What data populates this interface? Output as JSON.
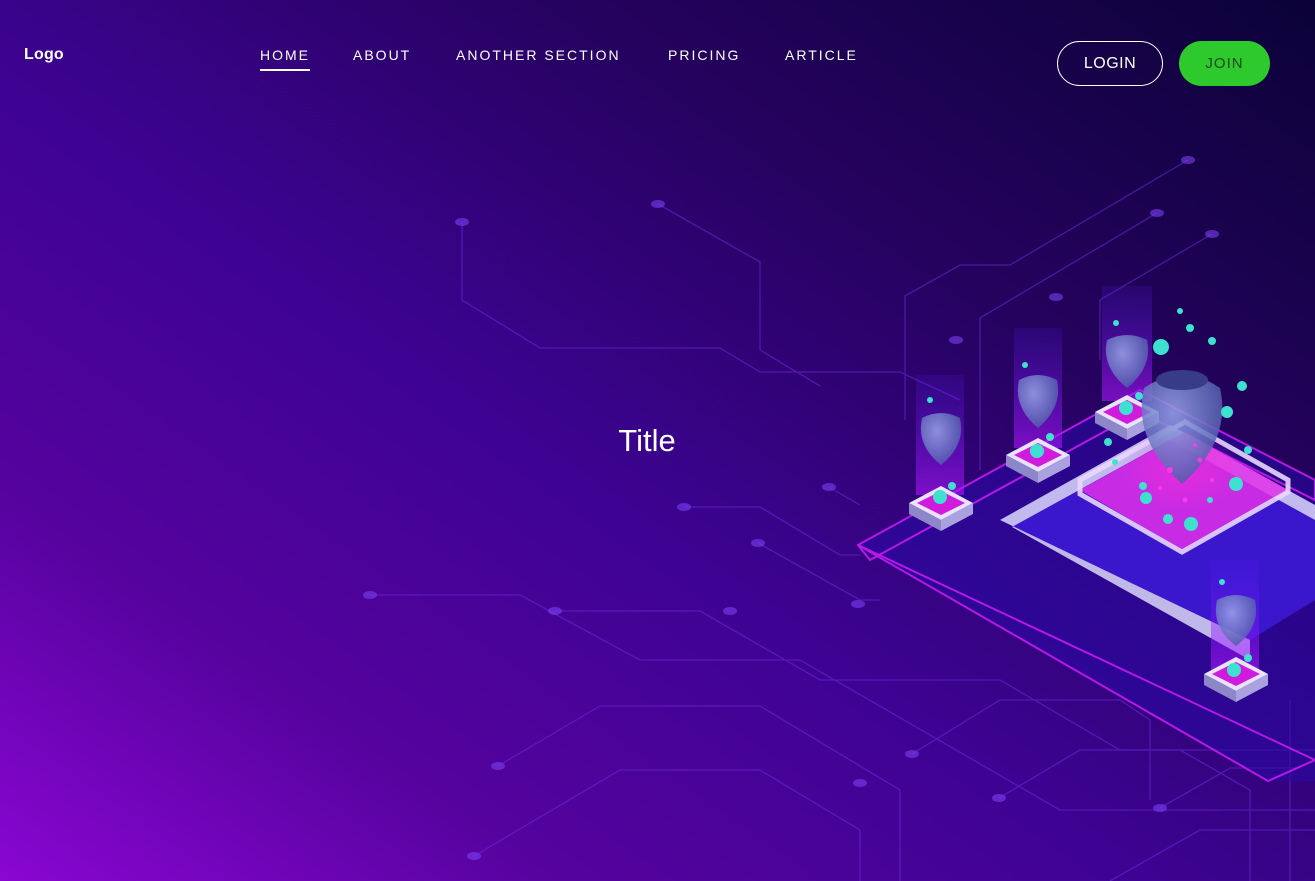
{
  "header": {
    "logo": "Logo",
    "nav": [
      {
        "label": "HOME",
        "active": true
      },
      {
        "label": "ABOUT",
        "active": false
      },
      {
        "label": "ANOTHER SECTION",
        "active": false
      },
      {
        "label": "PRICING",
        "active": false
      },
      {
        "label": "ARTICLE",
        "active": false
      }
    ],
    "login_label": "LOGIN",
    "join_label": "JOIN"
  },
  "hero": {
    "title": "Title"
  },
  "colors": {
    "accent_join": "#2dc92d",
    "background_gradient": [
      "#8a06d2",
      "#3d0392",
      "#0b0238"
    ],
    "circuit_line": "#7a2cff",
    "glow_magenta": "#d01bff",
    "orb_cyan": "#3ee0cf"
  }
}
